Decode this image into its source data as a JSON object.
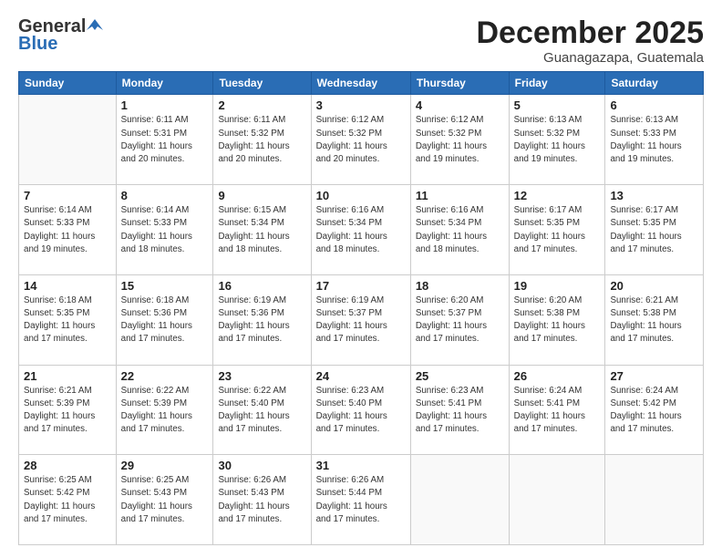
{
  "header": {
    "logo_general": "General",
    "logo_blue": "Blue",
    "month_title": "December 2025",
    "location": "Guanagazapa, Guatemala"
  },
  "weekdays": [
    "Sunday",
    "Monday",
    "Tuesday",
    "Wednesday",
    "Thursday",
    "Friday",
    "Saturday"
  ],
  "weeks": [
    [
      {
        "day": "",
        "info": ""
      },
      {
        "day": "1",
        "info": "Sunrise: 6:11 AM\nSunset: 5:31 PM\nDaylight: 11 hours\nand 20 minutes."
      },
      {
        "day": "2",
        "info": "Sunrise: 6:11 AM\nSunset: 5:32 PM\nDaylight: 11 hours\nand 20 minutes."
      },
      {
        "day": "3",
        "info": "Sunrise: 6:12 AM\nSunset: 5:32 PM\nDaylight: 11 hours\nand 20 minutes."
      },
      {
        "day": "4",
        "info": "Sunrise: 6:12 AM\nSunset: 5:32 PM\nDaylight: 11 hours\nand 19 minutes."
      },
      {
        "day": "5",
        "info": "Sunrise: 6:13 AM\nSunset: 5:32 PM\nDaylight: 11 hours\nand 19 minutes."
      },
      {
        "day": "6",
        "info": "Sunrise: 6:13 AM\nSunset: 5:33 PM\nDaylight: 11 hours\nand 19 minutes."
      }
    ],
    [
      {
        "day": "7",
        "info": "Sunrise: 6:14 AM\nSunset: 5:33 PM\nDaylight: 11 hours\nand 19 minutes."
      },
      {
        "day": "8",
        "info": "Sunrise: 6:14 AM\nSunset: 5:33 PM\nDaylight: 11 hours\nand 18 minutes."
      },
      {
        "day": "9",
        "info": "Sunrise: 6:15 AM\nSunset: 5:34 PM\nDaylight: 11 hours\nand 18 minutes."
      },
      {
        "day": "10",
        "info": "Sunrise: 6:16 AM\nSunset: 5:34 PM\nDaylight: 11 hours\nand 18 minutes."
      },
      {
        "day": "11",
        "info": "Sunrise: 6:16 AM\nSunset: 5:34 PM\nDaylight: 11 hours\nand 18 minutes."
      },
      {
        "day": "12",
        "info": "Sunrise: 6:17 AM\nSunset: 5:35 PM\nDaylight: 11 hours\nand 17 minutes."
      },
      {
        "day": "13",
        "info": "Sunrise: 6:17 AM\nSunset: 5:35 PM\nDaylight: 11 hours\nand 17 minutes."
      }
    ],
    [
      {
        "day": "14",
        "info": "Sunrise: 6:18 AM\nSunset: 5:35 PM\nDaylight: 11 hours\nand 17 minutes."
      },
      {
        "day": "15",
        "info": "Sunrise: 6:18 AM\nSunset: 5:36 PM\nDaylight: 11 hours\nand 17 minutes."
      },
      {
        "day": "16",
        "info": "Sunrise: 6:19 AM\nSunset: 5:36 PM\nDaylight: 11 hours\nand 17 minutes."
      },
      {
        "day": "17",
        "info": "Sunrise: 6:19 AM\nSunset: 5:37 PM\nDaylight: 11 hours\nand 17 minutes."
      },
      {
        "day": "18",
        "info": "Sunrise: 6:20 AM\nSunset: 5:37 PM\nDaylight: 11 hours\nand 17 minutes."
      },
      {
        "day": "19",
        "info": "Sunrise: 6:20 AM\nSunset: 5:38 PM\nDaylight: 11 hours\nand 17 minutes."
      },
      {
        "day": "20",
        "info": "Sunrise: 6:21 AM\nSunset: 5:38 PM\nDaylight: 11 hours\nand 17 minutes."
      }
    ],
    [
      {
        "day": "21",
        "info": "Sunrise: 6:21 AM\nSunset: 5:39 PM\nDaylight: 11 hours\nand 17 minutes."
      },
      {
        "day": "22",
        "info": "Sunrise: 6:22 AM\nSunset: 5:39 PM\nDaylight: 11 hours\nand 17 minutes."
      },
      {
        "day": "23",
        "info": "Sunrise: 6:22 AM\nSunset: 5:40 PM\nDaylight: 11 hours\nand 17 minutes."
      },
      {
        "day": "24",
        "info": "Sunrise: 6:23 AM\nSunset: 5:40 PM\nDaylight: 11 hours\nand 17 minutes."
      },
      {
        "day": "25",
        "info": "Sunrise: 6:23 AM\nSunset: 5:41 PM\nDaylight: 11 hours\nand 17 minutes."
      },
      {
        "day": "26",
        "info": "Sunrise: 6:24 AM\nSunset: 5:41 PM\nDaylight: 11 hours\nand 17 minutes."
      },
      {
        "day": "27",
        "info": "Sunrise: 6:24 AM\nSunset: 5:42 PM\nDaylight: 11 hours\nand 17 minutes."
      }
    ],
    [
      {
        "day": "28",
        "info": "Sunrise: 6:25 AM\nSunset: 5:42 PM\nDaylight: 11 hours\nand 17 minutes."
      },
      {
        "day": "29",
        "info": "Sunrise: 6:25 AM\nSunset: 5:43 PM\nDaylight: 11 hours\nand 17 minutes."
      },
      {
        "day": "30",
        "info": "Sunrise: 6:26 AM\nSunset: 5:43 PM\nDaylight: 11 hours\nand 17 minutes."
      },
      {
        "day": "31",
        "info": "Sunrise: 6:26 AM\nSunset: 5:44 PM\nDaylight: 11 hours\nand 17 minutes."
      },
      {
        "day": "",
        "info": ""
      },
      {
        "day": "",
        "info": ""
      },
      {
        "day": "",
        "info": ""
      }
    ]
  ]
}
